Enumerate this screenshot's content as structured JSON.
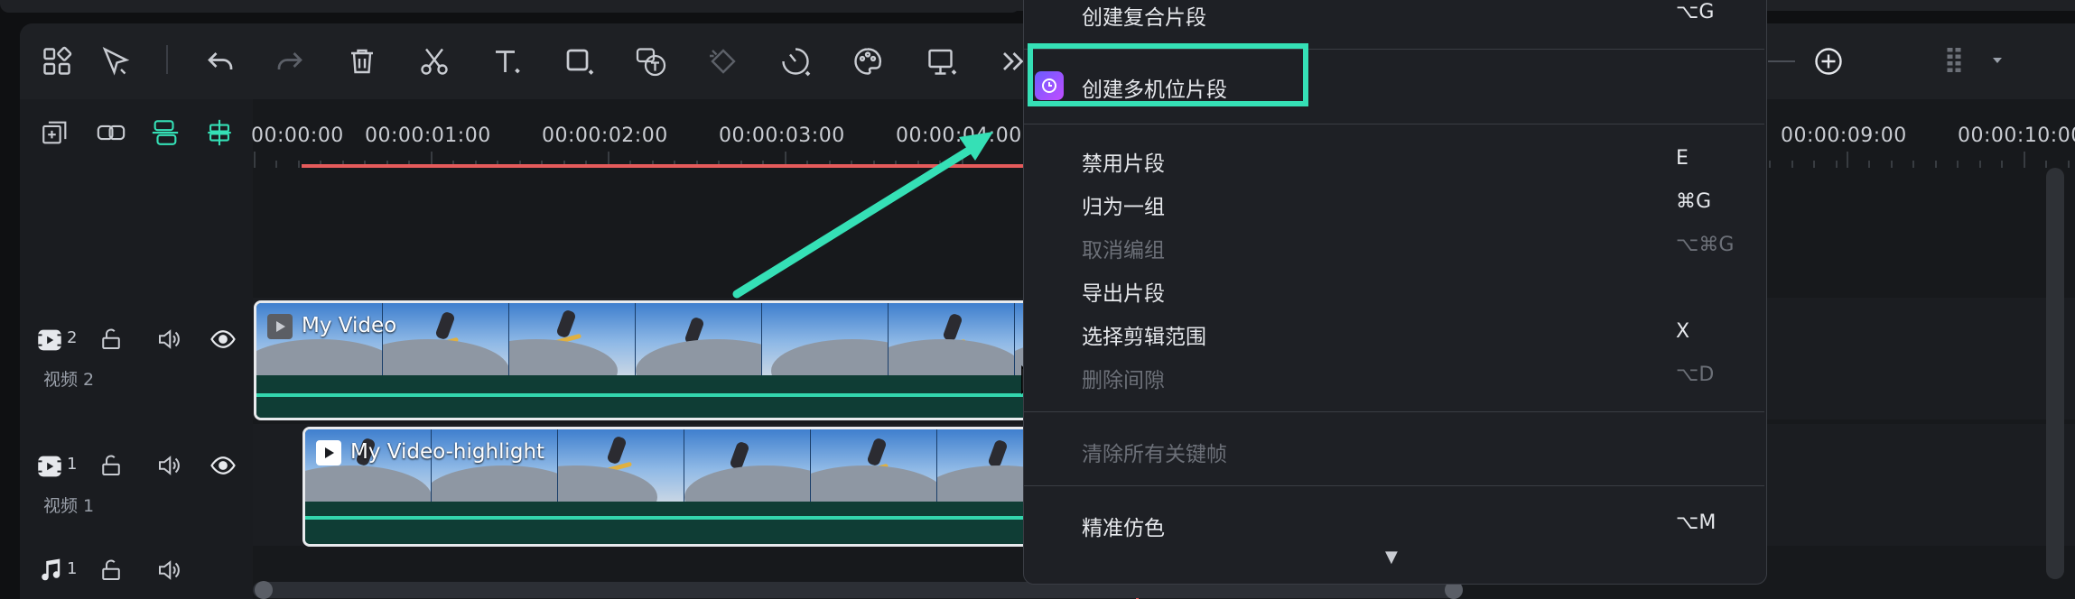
{
  "timeline": {
    "ruler": [
      "00:00:00",
      "00:00:01:00",
      "00:00:02:00",
      "00:00:03:00",
      "00:00:04:00",
      "00:00:09:00",
      "00:00:10:00"
    ],
    "tracks": [
      {
        "number": "2",
        "label": "视频 2"
      },
      {
        "number": "1",
        "label": "视频 1"
      },
      {
        "number": "1",
        "label": ""
      }
    ],
    "clips": [
      {
        "title": "My Video"
      },
      {
        "title": "My Video-highlight"
      }
    ]
  },
  "context_menu": {
    "items": [
      {
        "label": "创建复合片段",
        "shortcut": "⌥G",
        "enabled": true
      },
      {
        "label": "创建多机位片段",
        "shortcut": "",
        "enabled": true,
        "highlighted": true
      },
      {
        "label": "禁用片段",
        "shortcut": "E",
        "enabled": true
      },
      {
        "label": "归为一组",
        "shortcut": "⌘G",
        "enabled": true
      },
      {
        "label": "取消编组",
        "shortcut": "⌥⌘G",
        "enabled": false
      },
      {
        "label": "导出片段",
        "shortcut": "",
        "enabled": true
      },
      {
        "label": "选择剪辑范围",
        "shortcut": "X",
        "enabled": true
      },
      {
        "label": "删除间隙",
        "shortcut": "⌥D",
        "enabled": false
      },
      {
        "label": "清除所有关键帧",
        "shortcut": "",
        "enabled": false
      },
      {
        "label": "精准仿色",
        "shortcut": "⌥M",
        "enabled": true
      }
    ],
    "more_indicator": "▼"
  },
  "icons": {
    "toolbar": [
      "layout-icon",
      "select-tool-icon",
      "undo-icon",
      "redo-icon",
      "delete-icon",
      "cut-icon",
      "text-icon",
      "shape-icon",
      "speech-to-text-icon",
      "keyframe-icon",
      "speed-icon",
      "color-icon",
      "crop-icon",
      "more-icon",
      "zoom-in-icon",
      "track-options-icon"
    ],
    "track_header": [
      "add-track-icon",
      "link-icon",
      "snap-icon",
      "marker-icon"
    ]
  },
  "colors": {
    "accent": "#35e0b6",
    "playhead": "#e55b5b",
    "clip_audio": "#0f3d35",
    "menu_bg": "#1e2025",
    "multicam_icon": "#9b59ff"
  }
}
